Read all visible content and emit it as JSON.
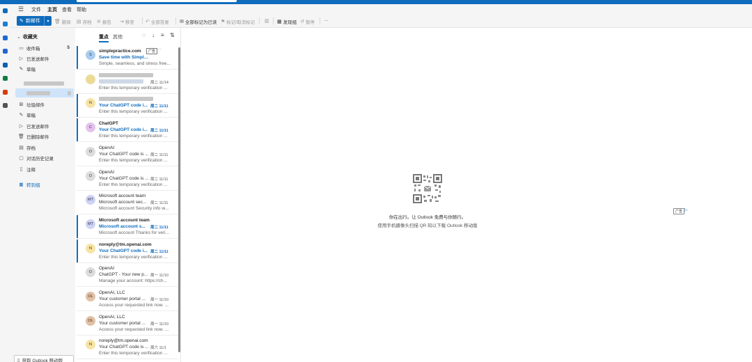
{
  "colors": {
    "brand": "#0f6cbd",
    "selected_bg": "#cfe4fa",
    "rail_bg": "#f5f5f5"
  },
  "app_rail": [
    {
      "name": "mail-app-icon",
      "color": "#0f6cbd"
    },
    {
      "name": "calendar-app-icon",
      "color": "#1a7fd4"
    },
    {
      "name": "people-app-icon",
      "color": "#1d6bd1"
    },
    {
      "name": "todo-app-icon",
      "color": "#2564cf"
    },
    {
      "name": "outlook-app-icon",
      "color": "#0a5fb4"
    },
    {
      "name": "excel-app-icon",
      "color": "#107c41"
    },
    {
      "name": "office-app-icon",
      "color": "#d83b01"
    },
    {
      "name": "more-apps-icon",
      "color": "#555555"
    }
  ],
  "menu": {
    "items": [
      "文件",
      "主页",
      "查看",
      "帮助"
    ],
    "active": "主页"
  },
  "ribbon": {
    "new_mail": "新邮件",
    "delete": "删除",
    "archive": "存档",
    "report": "报告",
    "move": "移至",
    "reply_all": "全部答复",
    "mark_all_read": "全部标记为已读",
    "flag": "标记/取消标记",
    "discover": "发现组",
    "snooze": "暂停",
    "more": "···"
  },
  "folders": {
    "favorites_header": "收藏夹",
    "favorites": [
      {
        "label": "收件箱",
        "count": "5",
        "icon": "inbox-icon"
      },
      {
        "label": "已发送邮件",
        "count": "",
        "icon": "sent-icon"
      },
      {
        "label": "草稿",
        "count": "",
        "icon": "draft-icon"
      }
    ],
    "account_folders": [
      {
        "label": "垃圾邮件",
        "icon": "junk-icon"
      },
      {
        "label": "草稿",
        "icon": "draft-icon"
      },
      {
        "label": "已发送邮件",
        "icon": "sent-icon"
      },
      {
        "label": "已删除邮件",
        "icon": "deleted-icon"
      },
      {
        "label": "存档",
        "icon": "archive-icon"
      },
      {
        "label": "对话历史记录",
        "icon": "history-icon"
      },
      {
        "label": "注释",
        "icon": "notes-icon"
      }
    ],
    "goto_groups": "转到组",
    "get_app": "获取 Outlook 移动版"
  },
  "message_list": {
    "tabs": [
      "重点",
      "其他"
    ],
    "active_tab": "重点",
    "messages": [
      {
        "sender": "simplepractice.com",
        "subject": "Save time with SimplePractice",
        "date": "",
        "preview": "Simple, seamless, and stress free...",
        "avatar": "S",
        "avatar_color": "#a9cdef",
        "unread": true,
        "badge": "广告",
        "more": "···"
      },
      {
        "sender": "",
        "subject": "",
        "date": "周二 11/14",
        "preview": "Enter this temporary verification ...",
        "avatar": "",
        "avatar_color": "#eadc97",
        "unread": false,
        "badge": "",
        "more": ""
      },
      {
        "sender": "",
        "subject": "Your ChatGPT code i...",
        "date": "周二 11/11",
        "preview": "Enter this temporary verification ...",
        "avatar": "N",
        "avatar_color": "#f7e3a3",
        "unread": true,
        "badge": "",
        "more": ""
      },
      {
        "sender": "ChatGPT",
        "subject": "Your ChatGPT code i...",
        "date": "周二 11/11",
        "preview": "Enter this temporary verification ...",
        "avatar": "C",
        "avatar_color": "#e3c3ee",
        "unread": true,
        "badge": "",
        "more": ""
      },
      {
        "sender": "OpenAI",
        "subject": "Your ChatGPT code is ...",
        "date": "周二 11/11",
        "preview": "Enter this temporary verification ...",
        "avatar": "O",
        "avatar_color": "#dcdcdc",
        "unread": false,
        "badge": "",
        "more": ""
      },
      {
        "sender": "OpenAI",
        "subject": "Your ChatGPT code is ...",
        "date": "周二 11/11",
        "preview": "Enter this temporary verification ...",
        "avatar": "O",
        "avatar_color": "#dcdcdc",
        "unread": false,
        "badge": "",
        "more": ""
      },
      {
        "sender": "Microsoft account team",
        "subject": "Microsoft account sec...",
        "date": "周二 11/11",
        "preview": "Microsoft account Security info w...",
        "avatar": "MT",
        "avatar_color": "#cdd3f5",
        "unread": false,
        "badge": "",
        "more": ""
      },
      {
        "sender": "Microsoft account team",
        "subject": "Microsoft account s...",
        "date": "周二 11/11",
        "preview": "Microsoft account Thanks for veri...",
        "avatar": "MT",
        "avatar_color": "#cdd3f5",
        "unread": true,
        "badge": "",
        "more": ""
      },
      {
        "sender": "noreply@tm.openai.com",
        "subject": "Your ChatGPT code i...",
        "date": "周二 11/11",
        "preview": "Enter this temporary verification ...",
        "avatar": "N",
        "avatar_color": "#f7e3a3",
        "unread": true,
        "badge": "",
        "more": ""
      },
      {
        "sender": "OpenAI",
        "subject": "ChatGPT - Your new p...",
        "date": "周一 11/10",
        "preview": "Manage your account: https://ch...",
        "avatar": "O",
        "avatar_color": "#dcdcdc",
        "unread": false,
        "badge": "",
        "more": ""
      },
      {
        "sender": "OpenAI, LLC",
        "subject": "Your customer portal ...",
        "date": "周一 11/10",
        "preview": "Access your requested link now. ...",
        "avatar": "OL",
        "avatar_color": "#e2c0a4",
        "unread": false,
        "badge": "",
        "more": ""
      },
      {
        "sender": "OpenAI, LLC",
        "subject": "Your customer portal ...",
        "date": "周一 11/10",
        "preview": "Access your requested link now. ...",
        "avatar": "OL",
        "avatar_color": "#e2c0a4",
        "unread": false,
        "badge": "",
        "more": ""
      },
      {
        "sender": "noreply@tm.openai.com",
        "subject": "Your ChatGPT code is ...",
        "date": "周六 11/1",
        "preview": "Enter this temporary verification ...",
        "avatar": "N",
        "avatar_color": "#f7e3a3",
        "unread": false,
        "badge": "",
        "more": ""
      }
    ]
  },
  "reading_pane": {
    "line1": "你在出行。让 Outlook 免费与你随行。",
    "line2": "使用手机摄像头扫描 QR 码以下载 Outlook 移动版",
    "ad_badge": "广告"
  }
}
